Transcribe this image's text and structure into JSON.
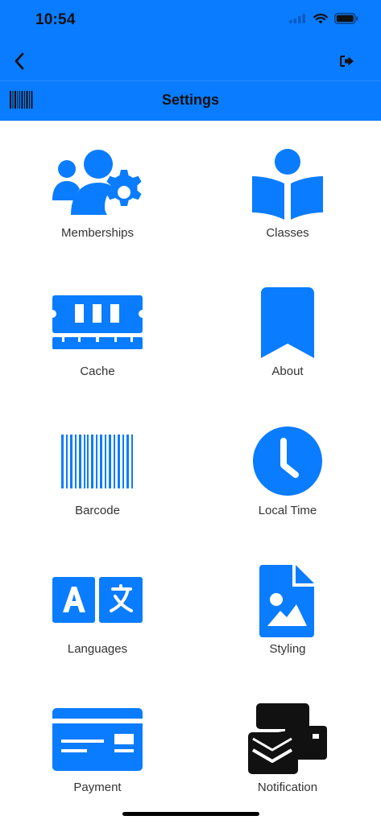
{
  "status_bar": {
    "time": "10:54"
  },
  "header": {
    "title": "Settings"
  },
  "icons": {
    "back": "chevron-left-icon",
    "logout": "sign-out-icon",
    "barcode": "barcode-icon"
  },
  "colors": {
    "accent": "#0a7cff",
    "notification": "#111111",
    "label": "#333333"
  },
  "tiles": [
    {
      "label": "Memberships",
      "icon": "users-gear-icon"
    },
    {
      "label": "Classes",
      "icon": "reader-book-icon"
    },
    {
      "label": "Cache",
      "icon": "memory-icon"
    },
    {
      "label": "About",
      "icon": "bookmark-icon"
    },
    {
      "label": "Barcode",
      "icon": "barcode-icon"
    },
    {
      "label": "Local Time",
      "icon": "clock-icon"
    },
    {
      "label": "Languages",
      "icon": "language-icon"
    },
    {
      "label": "Styling",
      "icon": "file-image-icon"
    },
    {
      "label": "Payment",
      "icon": "credit-card-icon"
    },
    {
      "label": "Notification",
      "icon": "envelopes-icon"
    }
  ]
}
